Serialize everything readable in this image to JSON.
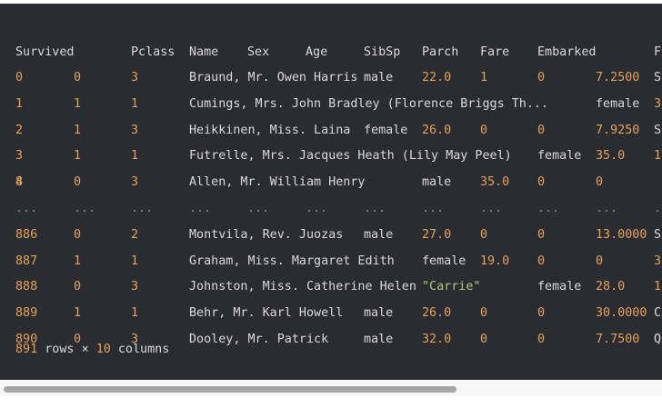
{
  "table": {
    "columns": [
      "Survived",
      "Pclass",
      "Name",
      "Sex",
      "Age",
      "SibSp",
      "Parch",
      "Fare",
      "Embarked",
      "F"
    ],
    "rows": [
      [
        {
          "t": "0",
          "k": "num"
        },
        {
          "t": "0",
          "k": "num"
        },
        {
          "t": "3",
          "k": "num"
        },
        {
          "t": "Braund, Mr. Owen Harris",
          "k": "txt"
        },
        {
          "t": "male",
          "k": "txt"
        },
        {
          "t": "22.0",
          "k": "num"
        },
        {
          "t": "1",
          "k": "num"
        },
        {
          "t": "0",
          "k": "num"
        },
        {
          "t": "7.2500",
          "k": "num"
        },
        {
          "t": "S",
          "k": "txt"
        }
      ],
      [
        {
          "t": "1",
          "k": "num"
        },
        {
          "t": "1",
          "k": "num"
        },
        {
          "t": "1",
          "k": "num"
        },
        {
          "t": "Cumings, Mrs. John Bradley (Florence Briggs Th...",
          "k": "txt"
        },
        {
          "t": "female",
          "k": "txt"
        },
        {
          "t": "3",
          "k": "num"
        }
      ],
      [
        {
          "t": "2",
          "k": "num"
        },
        {
          "t": "1",
          "k": "num"
        },
        {
          "t": "3",
          "k": "num"
        },
        {
          "t": "Heikkinen, Miss. Laina",
          "k": "txt"
        },
        {
          "t": "female",
          "k": "txt"
        },
        {
          "t": "26.0",
          "k": "num"
        },
        {
          "t": "0",
          "k": "num"
        },
        {
          "t": "0",
          "k": "num"
        },
        {
          "t": "7.9250",
          "k": "num"
        },
        {
          "t": "S",
          "k": "txt"
        }
      ],
      [
        {
          "t": "3",
          "k": "num"
        },
        {
          "t": "1",
          "k": "num"
        },
        {
          "t": "1",
          "k": "num"
        },
        {
          "t": "Futrelle, Mrs. Jacques Heath (Lily May Peel)",
          "k": "txt"
        },
        {
          "t": "female",
          "k": "txt"
        },
        {
          "t": "35.0",
          "k": "num"
        },
        {
          "t": "1",
          "k": "num"
        }
      ],
      [
        {
          "t": "4",
          "k": "num"
        },
        {
          "t": "0",
          "k": "num"
        },
        {
          "t": "3",
          "k": "num"
        },
        {
          "t": "Allen, Mr. William Henry",
          "k": "txt"
        },
        {
          "t": "male",
          "k": "txt"
        },
        {
          "t": "35.0",
          "k": "num"
        },
        {
          "t": "0",
          "k": "num"
        },
        {
          "t": "0",
          "k": "num"
        },
        {
          "t": "8",
          "k": "num"
        }
      ],
      [
        {
          "t": "...",
          "k": "dots"
        },
        {
          "t": "...",
          "k": "dots"
        },
        {
          "t": "...",
          "k": "dots"
        },
        {
          "t": "...",
          "k": "dots"
        },
        {
          "t": "...",
          "k": "dots"
        },
        {
          "t": "...",
          "k": "dots"
        },
        {
          "t": "...",
          "k": "dots"
        },
        {
          "t": "...",
          "k": "dots"
        },
        {
          "t": "...",
          "k": "dots"
        },
        {
          "t": "...",
          "k": "dots"
        },
        {
          "t": "...",
          "k": "dots"
        },
        {
          "t": "...",
          "k": "dots"
        }
      ],
      [
        {
          "t": "886",
          "k": "num"
        },
        {
          "t": "0",
          "k": "num"
        },
        {
          "t": "2",
          "k": "num"
        },
        {
          "t": "Montvila, Rev. Juozas",
          "k": "txt"
        },
        {
          "t": "male",
          "k": "txt"
        },
        {
          "t": "27.0",
          "k": "num"
        },
        {
          "t": "0",
          "k": "num"
        },
        {
          "t": "0",
          "k": "num"
        },
        {
          "t": "13.0000",
          "k": "num"
        },
        {
          "t": "S",
          "k": "txt"
        }
      ],
      [
        {
          "t": "887",
          "k": "num"
        },
        {
          "t": "1",
          "k": "num"
        },
        {
          "t": "1",
          "k": "num"
        },
        {
          "t": "Graham, Miss. Margaret Edith",
          "k": "txt"
        },
        {
          "t": "female",
          "k": "txt"
        },
        {
          "t": "19.0",
          "k": "num"
        },
        {
          "t": "0",
          "k": "num"
        },
        {
          "t": "0",
          "k": "num"
        },
        {
          "t": "3",
          "k": "num"
        }
      ],
      [
        {
          "t": "888",
          "k": "num"
        },
        {
          "t": "0",
          "k": "num"
        },
        {
          "t": "3",
          "k": "num"
        },
        {
          "t": "Johnston, Miss. Catherine Helen ",
          "k": "txt"
        },
        {
          "t": "\"Carrie\"",
          "k": "str"
        },
        {
          "t": "female",
          "k": "txt"
        },
        {
          "t": "28.0",
          "k": "num"
        },
        {
          "t": "1",
          "k": "num"
        }
      ],
      [
        {
          "t": "889",
          "k": "num"
        },
        {
          "t": "1",
          "k": "num"
        },
        {
          "t": "1",
          "k": "num"
        },
        {
          "t": "Behr, Mr. Karl Howell",
          "k": "txt"
        },
        {
          "t": "male",
          "k": "txt"
        },
        {
          "t": "26.0",
          "k": "num"
        },
        {
          "t": "0",
          "k": "num"
        },
        {
          "t": "0",
          "k": "num"
        },
        {
          "t": "30.0000",
          "k": "num"
        },
        {
          "t": "C",
          "k": "txt"
        }
      ],
      [
        {
          "t": "890",
          "k": "num"
        },
        {
          "t": "0",
          "k": "num"
        },
        {
          "t": "3",
          "k": "num"
        },
        {
          "t": "Dooley, Mr. Patrick",
          "k": "txt"
        },
        {
          "t": "male",
          "k": "txt"
        },
        {
          "t": "32.0",
          "k": "num"
        },
        {
          "t": "0",
          "k": "num"
        },
        {
          "t": "0",
          "k": "num"
        },
        {
          "t": "7.7500",
          "k": "num"
        },
        {
          "t": "Q",
          "k": "txt"
        }
      ]
    ]
  },
  "footer": {
    "rows_count": "891",
    "rows_word": "rows",
    "times": "×",
    "cols_count": "10",
    "cols_word": "columns"
  },
  "colors": {
    "background": "#2b2c31",
    "text": "#d9d9d9",
    "number": "#e2a15c",
    "string": "#a9c77a",
    "scrollbar_thumb": "#a6a6a6"
  }
}
